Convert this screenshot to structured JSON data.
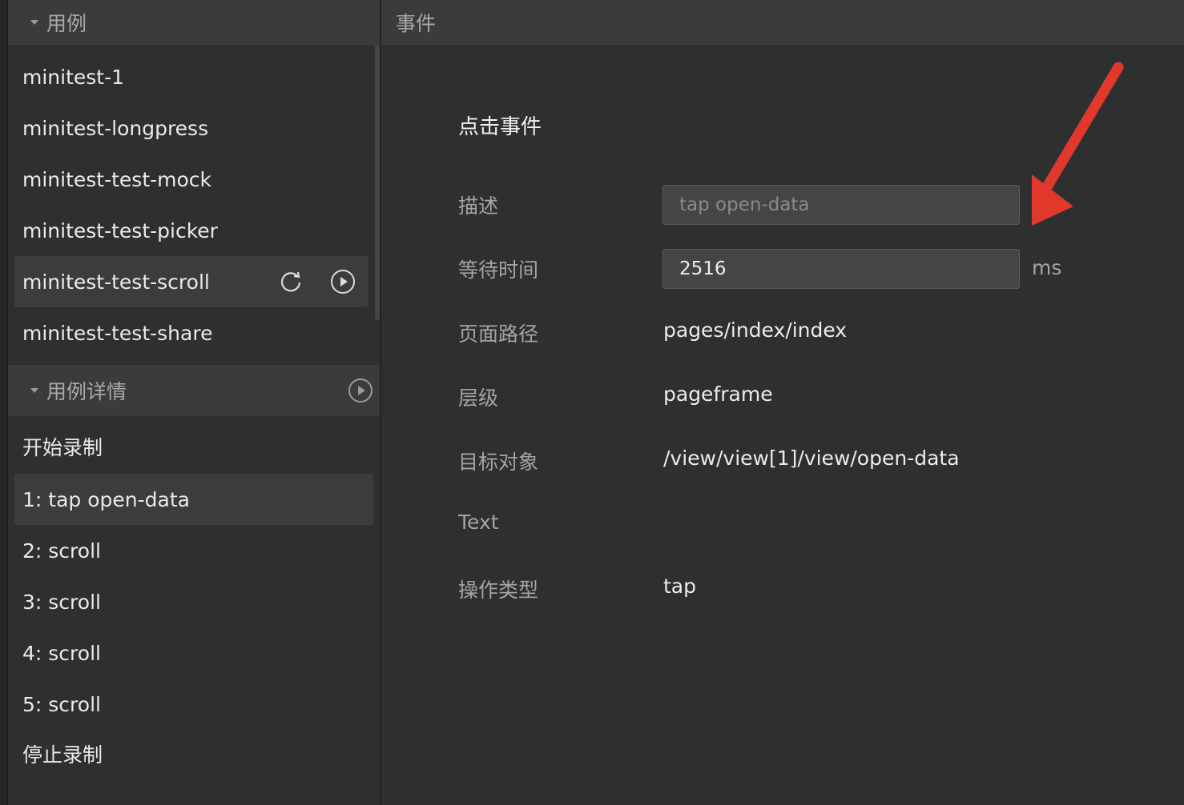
{
  "sidebar": {
    "cases_title": "用例",
    "cases": [
      {
        "label": "minitest-1"
      },
      {
        "label": "minitest-longpress"
      },
      {
        "label": "minitest-test-mock"
      },
      {
        "label": "minitest-test-picker"
      },
      {
        "label": "minitest-test-scroll"
      },
      {
        "label": "minitest-test-share"
      }
    ],
    "details_title": "用例详情",
    "steps": [
      {
        "label": "开始录制"
      },
      {
        "label": "1: tap open-data"
      },
      {
        "label": "2: scroll"
      },
      {
        "label": "3: scroll"
      },
      {
        "label": "4: scroll"
      },
      {
        "label": "5: scroll"
      },
      {
        "label": "停止录制"
      }
    ]
  },
  "main": {
    "title": "事件",
    "event_heading": "点击事件",
    "fields": {
      "desc_label": "描述",
      "desc_placeholder": "tap open-data",
      "wait_label": "等待时间",
      "wait_value": "2516",
      "wait_unit": "ms",
      "path_label": "页面路径",
      "path_value": "pages/index/index",
      "level_label": "层级",
      "level_value": "pageframe",
      "target_label": "目标对象",
      "target_value": "/view/view[1]/view/open-data",
      "text_label": "Text",
      "text_value": "",
      "op_label": "操作类型",
      "op_value": "tap"
    }
  },
  "colors": {
    "background": "#2e2f31",
    "header": "#3a3b3d",
    "selected": "#3b3c3e",
    "annotation_arrow": "#e0392b"
  }
}
